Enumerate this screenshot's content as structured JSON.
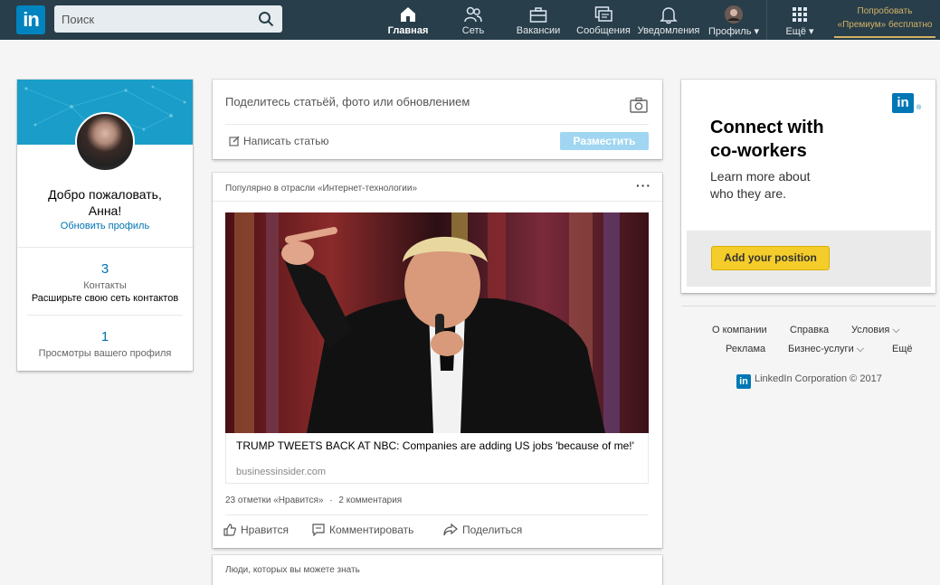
{
  "brand": {
    "logo_text": "in",
    "color": "#0084bf"
  },
  "search": {
    "placeholder": "Поиск",
    "icon": "search-icon"
  },
  "nav": {
    "home": "Главная",
    "network": "Сеть",
    "jobs": "Вакансии",
    "messages": "Сообщения",
    "notifications": "Уведомления",
    "profile": "Профиль",
    "more": "Ещё",
    "premium_line1": "Попробовать",
    "premium_line2": "«Премиум» бесплатно"
  },
  "profile_card": {
    "welcome_line1": "Добро пожаловать,",
    "welcome_line2": "Анна!",
    "update_link": "Обновить профиль",
    "connections_count": "3",
    "connections_label": "Контакты",
    "grow_network": "Расширьте свою сеть контактов",
    "views_count": "1",
    "views_label": "Просмотры вашего профиля"
  },
  "share_box": {
    "prompt": "Поделитесь статьёй, фото или обновлением",
    "write_article": "Написать статью",
    "post_button": "Разместить"
  },
  "feed": {
    "header": "Популярно в отрасли «Интернет-технологии»",
    "more": "···",
    "link_title": "TRUMP TWEETS BACK AT NBC: Companies are adding US jobs 'because of me!'",
    "link_source": "businessinsider.com",
    "likes": "23 отметки «Нравится»",
    "separator": "·",
    "comments": "2 комментария",
    "like_action": "Нравится",
    "comment_action": "Комментировать",
    "share_action": "Поделиться"
  },
  "people": {
    "header": "Люди, которых вы можете знать"
  },
  "ad": {
    "logo": "in",
    "reg": "®",
    "title_line1": "Connect with",
    "title_line2": "co-workers",
    "sub_line1": "Learn more about",
    "sub_line2": "who they are.",
    "button": "Add your position"
  },
  "footer": {
    "about": "О компании",
    "help": "Справка",
    "terms": "Условия",
    "ads": "Реклама",
    "business": "Бизнес-услуги",
    "more": "Ещё",
    "corp": "LinkedIn Corporation © 2017"
  },
  "colors": {
    "topbar": "#283e4a",
    "link": "#0073b1",
    "banner": "#1a9ec9",
    "premium": "#d4b266",
    "ad_button": "#f5cd2a"
  }
}
